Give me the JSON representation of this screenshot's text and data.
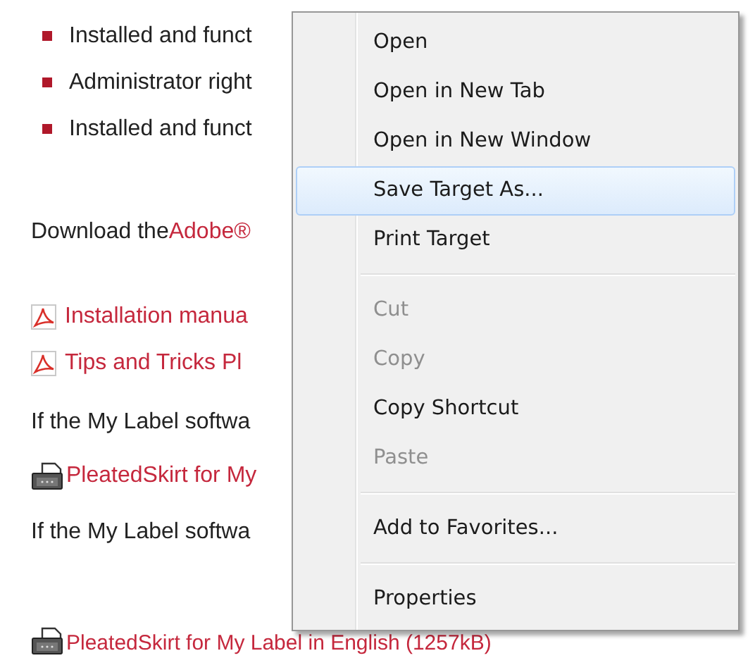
{
  "bullets": [
    "Installed and funct",
    "Administrator right",
    "Installed and funct"
  ],
  "download_line": {
    "text": "Download the ",
    "link": "Adobe®"
  },
  "pdf_links": [
    "Installation manua",
    "Tips and Tricks Pl"
  ],
  "sections": [
    {
      "text": "If the My Label softwa",
      "link": "PleatedSkirt for My"
    },
    {
      "text": "If the My Label softwa",
      "link": "PleatedSkirt for My Label in English (1257kB)"
    }
  ],
  "context_menu": {
    "items": [
      {
        "kind": "item",
        "label": "Open",
        "disabled": false,
        "selected": false
      },
      {
        "kind": "item",
        "label": "Open in New Tab",
        "disabled": false,
        "selected": false
      },
      {
        "kind": "item",
        "label": "Open in New Window",
        "disabled": false,
        "selected": false
      },
      {
        "kind": "item",
        "label": "Save Target As...",
        "disabled": false,
        "selected": true
      },
      {
        "kind": "item",
        "label": "Print Target",
        "disabled": false,
        "selected": false
      },
      {
        "kind": "separator"
      },
      {
        "kind": "item",
        "label": "Cut",
        "disabled": true,
        "selected": false
      },
      {
        "kind": "item",
        "label": "Copy",
        "disabled": true,
        "selected": false
      },
      {
        "kind": "item",
        "label": "Copy Shortcut",
        "disabled": false,
        "selected": false
      },
      {
        "kind": "item",
        "label": "Paste",
        "disabled": true,
        "selected": false
      },
      {
        "kind": "separator"
      },
      {
        "kind": "item",
        "label": "Add to Favorites...",
        "disabled": false,
        "selected": false
      },
      {
        "kind": "separator"
      },
      {
        "kind": "item",
        "label": "Properties",
        "disabled": false,
        "selected": false
      }
    ]
  }
}
